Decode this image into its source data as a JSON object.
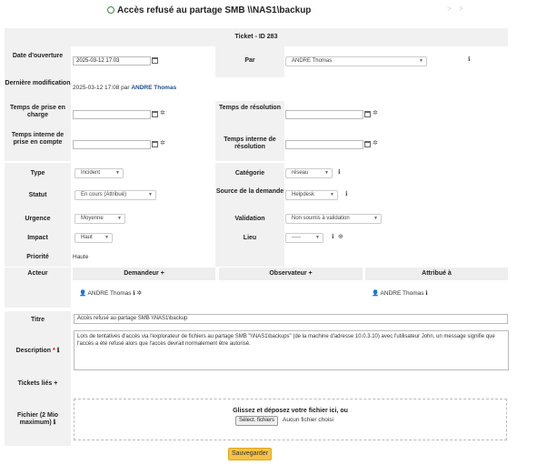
{
  "header": {
    "title": "Accès refusé au partage SMB \\\\NAS1\\backup",
    "nav_arrows": "> >"
  },
  "ticket": {
    "heading": "Ticket - ID 283"
  },
  "labels": {
    "date_ouverture": "Date d'ouverture",
    "par": "Par",
    "derniere_modif": "Dernière modification",
    "temps_prise_charge": "Temps de prise en charge",
    "temps_resolution": "Temps de résolution",
    "temps_interne_prise": "Temps interne de prise en compte",
    "temps_interne_resolution": "Temps interne de résolution",
    "type": "Type",
    "categorie": "Catégorie",
    "statut": "Statut",
    "source": "Source de la demande",
    "urgence": "Urgence",
    "validation": "Validation",
    "impact": "Impact",
    "lieu": "Lieu",
    "priorite": "Priorité",
    "acteur": "Acteur",
    "titre": "Titre",
    "description": "Description",
    "tickets_lies": "Tickets liés",
    "fichier": "Fichier (2 Mio maximum)"
  },
  "values": {
    "date_ouverture": "2025-03-12 17:03",
    "par": "ANDRE Thomas",
    "derniere_modif_prefix": "2025-03-12 17:08 par",
    "derniere_modif_user": "ANDRE Thomas",
    "type": "Incident",
    "categorie": "réseau",
    "statut": "En cours (Attribué)",
    "source": "Helpdesk",
    "urgence": "Moyenne",
    "validation": "Non soumis à validation",
    "impact": "Haut",
    "lieu": "-----",
    "priorite": "Haute"
  },
  "actors": {
    "demandeur_header": "Demandeur",
    "observateur_header": "Observateur",
    "attribue_header": "Attribué à",
    "demandeur": "ANDRE Thomas",
    "attribue": "ANDRE Thomas"
  },
  "titre_value": "Accès refusé au partage SMB \\\\NAS1\\backup",
  "description_text": "Lors de tentatives d'accès via l'explorateur de fichiers au partage SMB \"\\\\NAS1\\backups\" (de la machine d'adresse 10.0.3.10) avec l'utilisateur John, un message signifie que l'accès a été refusé alors que l'accès devrait normalement être autorisé.",
  "upload": {
    "drop_text": "Glissez et déposez votre fichier ici, ou",
    "choose_button": "Sélect. fichiers",
    "no_file": "Aucun fichier choisi"
  },
  "save_button": "Sauvegarder",
  "colors": {
    "save": "#f7c244",
    "link": "#1f4e8c",
    "label_bg": "#f1f1f1"
  }
}
